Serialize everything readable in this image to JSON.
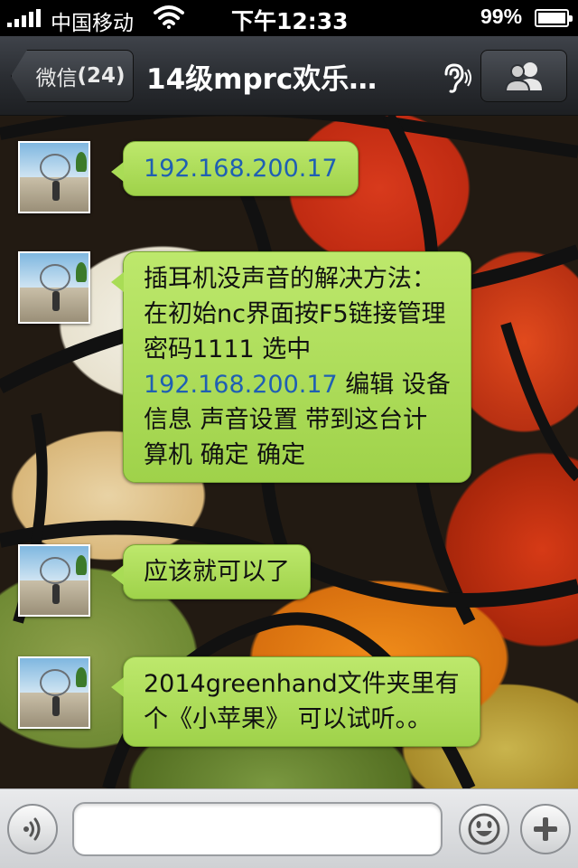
{
  "status_bar": {
    "carrier": "中国移动",
    "time": "下午12:33",
    "battery_percent": "99%",
    "battery_level": 0.99
  },
  "nav_bar": {
    "back_label": "微信",
    "back_count": "(24)",
    "title": "14级mprc欢乐…",
    "icons": [
      "ear-icon",
      "group-icon"
    ]
  },
  "messages": [
    {
      "lines": [
        [
          {
            "text": "192.168.200.17",
            "link": true
          }
        ]
      ]
    },
    {
      "lines": [
        [
          {
            "text": "插耳机没声音的解决方法：",
            "link": false
          }
        ],
        [
          {
            "text": "在初始nc界面按F5链接管理",
            "link": false
          }
        ],
        [
          {
            "text": " 密码1111 选中",
            "link": false
          }
        ],
        [
          {
            "text": "192.168.200.17",
            "link": true
          },
          {
            "text": " 编辑 设备",
            "link": false
          }
        ],
        [
          {
            "text": "信息 声音设置 带到这台计",
            "link": false
          }
        ],
        [
          {
            "text": "算机 确定 确定",
            "link": false
          }
        ]
      ]
    },
    {
      "lines": [
        [
          {
            "text": "应该就可以了",
            "link": false
          }
        ]
      ]
    },
    {
      "lines": [
        [
          {
            "text": "2014greenhand文件夹里有",
            "link": false
          }
        ],
        [
          {
            "text": "个《小苹果》 可以试听。。",
            "link": false
          }
        ]
      ]
    }
  ],
  "input_bar": {
    "placeholder": "",
    "icons": [
      "voice-icon",
      "emoji-icon",
      "plus-icon"
    ]
  },
  "colors": {
    "bubble": "#a9dc56",
    "link": "#1f5fb3",
    "nav": "#2b2e33"
  }
}
